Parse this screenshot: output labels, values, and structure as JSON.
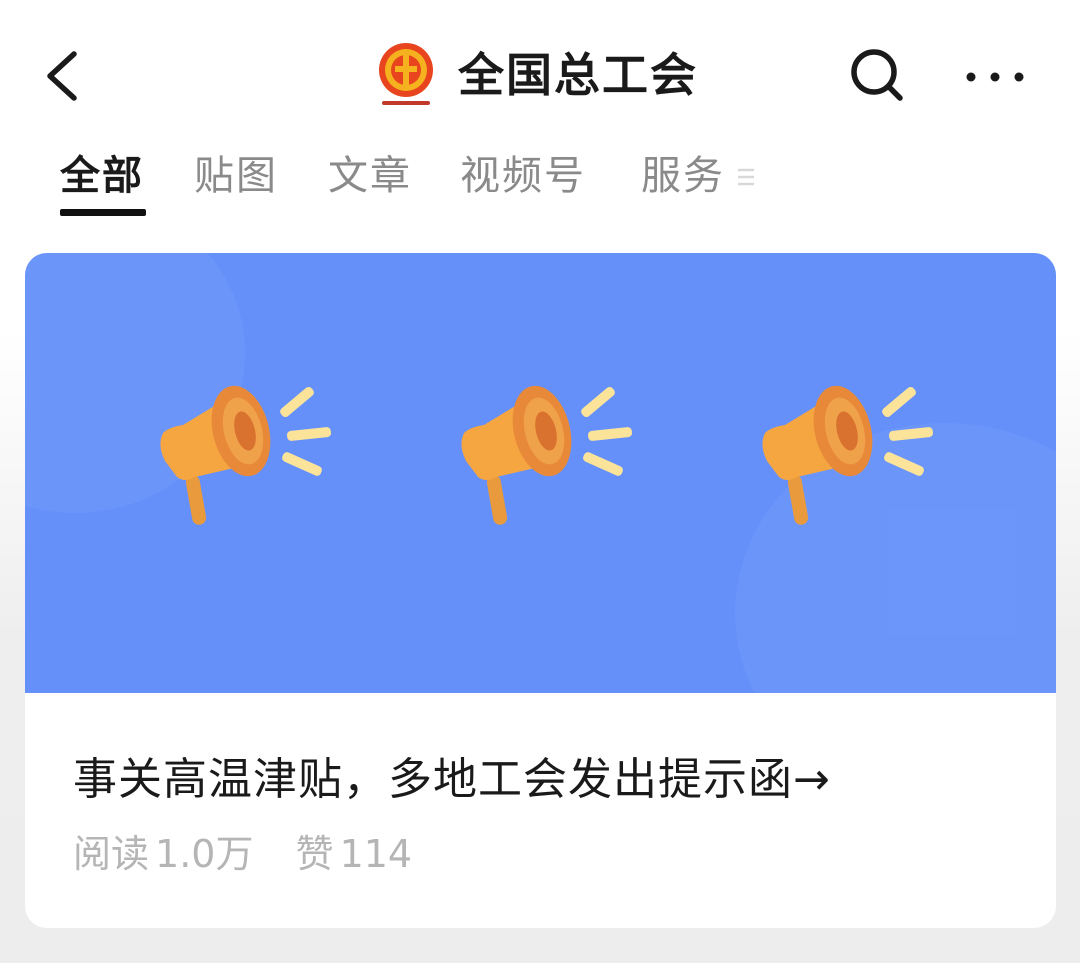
{
  "header": {
    "title": "全国总工会",
    "icons": [
      "back-arrow-icon",
      "union-logo",
      "search-icon",
      "more-dots-icon"
    ]
  },
  "tabs": [
    {
      "label": "全部",
      "active": true
    },
    {
      "label": "贴图",
      "active": false
    },
    {
      "label": "文章",
      "active": false
    },
    {
      "label": "视频号",
      "active": false
    },
    {
      "label": "服务",
      "active": false
    }
  ],
  "article": {
    "title": "事关高温津贴，多地工会发出提示函→",
    "banner_icons": [
      "megaphone-icon",
      "megaphone-icon",
      "megaphone-icon"
    ],
    "banner_color": "#6590fa",
    "reads_label": "阅读",
    "reads_value": "1.0万",
    "likes_label": "赞",
    "likes_value": "114"
  }
}
